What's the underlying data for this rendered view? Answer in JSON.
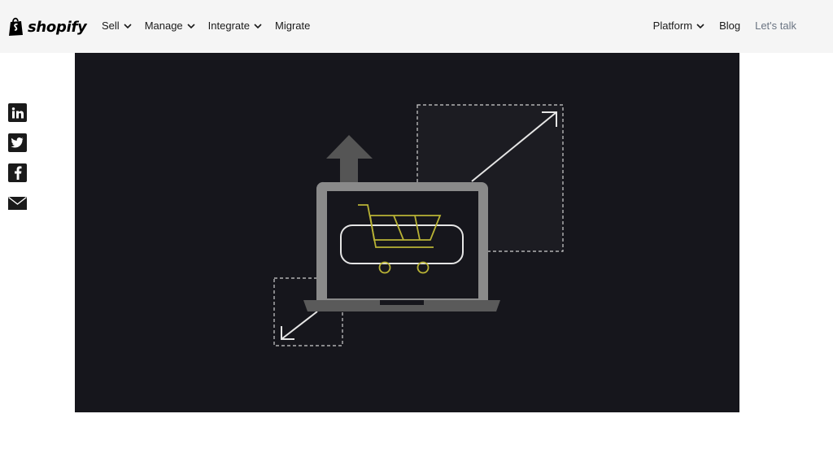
{
  "header": {
    "logo_text": "shopify",
    "nav_left": [
      {
        "label": "Sell",
        "has_dropdown": true
      },
      {
        "label": "Manage",
        "has_dropdown": true
      },
      {
        "label": "Integrate",
        "has_dropdown": true
      },
      {
        "label": "Migrate",
        "has_dropdown": false
      }
    ],
    "nav_right": [
      {
        "label": "Platform",
        "has_dropdown": true
      },
      {
        "label": "Blog",
        "has_dropdown": false
      },
      {
        "label": "Let's talk",
        "has_dropdown": false
      }
    ]
  },
  "share": {
    "icons": [
      "linkedin-icon",
      "twitter-icon",
      "facebook-icon",
      "email-icon"
    ]
  },
  "hero": {
    "illustration": "laptop-shopping-cart-scaling",
    "colors": {
      "background": "#16161c",
      "laptop": "#8a8a8a",
      "cart": "#b9b335",
      "arrow": "#555555",
      "line": "#dddddd"
    }
  }
}
